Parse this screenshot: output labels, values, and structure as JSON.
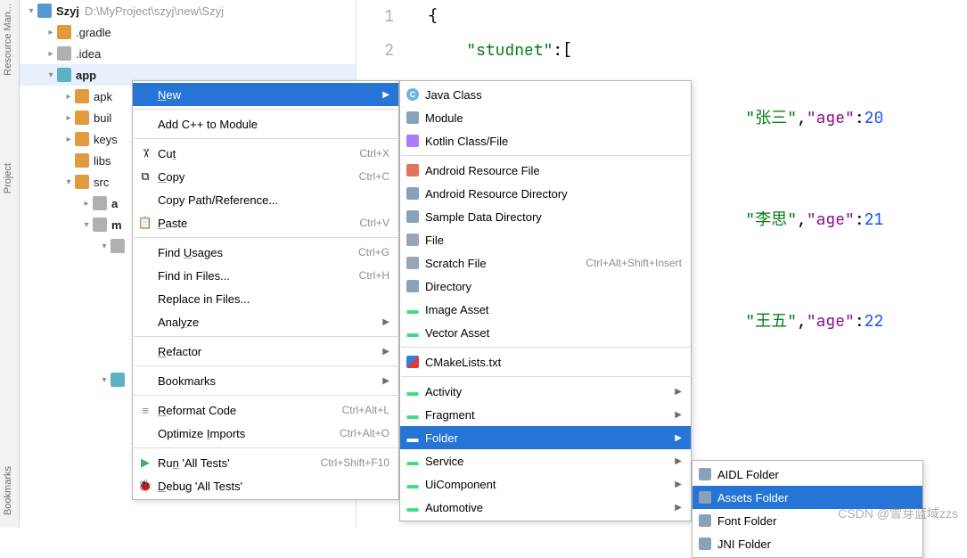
{
  "sidebar_tabs": [
    "Resource Man...",
    "Project",
    "Bookmarks"
  ],
  "tree": {
    "root_name": "Szyj",
    "root_path": "D:\\MyProject\\szyj\\new\\Szyj",
    "children": [
      {
        "name": ".gradle",
        "icon": "folder-orange"
      },
      {
        "name": ".idea",
        "icon": "folder-grey"
      },
      {
        "name": "app",
        "icon": "folder-teal",
        "bold": true,
        "selected": true,
        "expanded": true,
        "children": [
          {
            "name": "apk"
          },
          {
            "name": "buil"
          },
          {
            "name": "keys"
          },
          {
            "name": "libs"
          },
          {
            "name": "src",
            "expanded": true,
            "children": [
              {
                "name": "a",
                "bold": true
              },
              {
                "name": "m",
                "bold": true,
                "expanded": true,
                "children": [
                  {
                    "name": ""
                  },
                  {
                    "name": ""
                  }
                ]
              }
            ]
          }
        ]
      }
    ]
  },
  "editor": {
    "lines_visible": [
      "1",
      "2"
    ],
    "code": {
      "l1": "{",
      "key_studnet": "\"studnet\"",
      "arr_open": ":[",
      "row1_name": "\"张三\"",
      "row1_agek": "\"age\"",
      "row1_agev": "20",
      "row2_name": "\"李思\"",
      "row2_agek": "\"age\"",
      "row2_agev": "21",
      "row3_name": "\"王五\"",
      "row3_agek": "\"age\"",
      "row3_agev": "22"
    }
  },
  "ctx": {
    "items": [
      {
        "label": "New",
        "hl": true,
        "arrow": true,
        "u": 0
      },
      {
        "sep": true
      },
      {
        "label": "Add C++ to Module"
      },
      {
        "sep": true
      },
      {
        "icon": "scissors",
        "label": "Cut",
        "sc": "Ctrl+X",
        "u": 2
      },
      {
        "icon": "copy",
        "label": "Copy",
        "sc": "Ctrl+C",
        "u": 0
      },
      {
        "label": "Copy Path/Reference..."
      },
      {
        "icon": "paste",
        "label": "Paste",
        "sc": "Ctrl+V",
        "u": 0
      },
      {
        "sep": true
      },
      {
        "label": "Find Usages",
        "sc": "Ctrl+G",
        "u": 5
      },
      {
        "label": "Find in Files...",
        "sc": "Ctrl+H"
      },
      {
        "label": "Replace in Files..."
      },
      {
        "label": "Analyze",
        "arrow": true,
        "u": 4
      },
      {
        "sep": true
      },
      {
        "label": "Refactor",
        "arrow": true,
        "u": 0
      },
      {
        "sep": true
      },
      {
        "label": "Bookmarks",
        "arrow": true
      },
      {
        "sep": true
      },
      {
        "icon": "reformat",
        "label": "Reformat Code",
        "sc": "Ctrl+Alt+L",
        "u": 0
      },
      {
        "label": "Optimize Imports",
        "sc": "Ctrl+Alt+O",
        "u": 9
      },
      {
        "sep": true
      },
      {
        "icon": "play",
        "label": "Run 'All Tests'",
        "sc": "Ctrl+Shift+F10",
        "u": 2
      },
      {
        "icon": "bug",
        "label": "Debug 'All Tests'",
        "u": 0
      }
    ]
  },
  "sub": {
    "items": [
      {
        "icon": "java",
        "label": "Java Class"
      },
      {
        "icon": "folder",
        "label": "Module"
      },
      {
        "icon": "kotlin",
        "label": "Kotlin Class/File"
      },
      {
        "sep": true
      },
      {
        "icon": "xml",
        "label": "Android Resource File"
      },
      {
        "icon": "folder",
        "label": "Android Resource Directory"
      },
      {
        "icon": "folder",
        "label": "Sample Data Directory"
      },
      {
        "icon": "file",
        "label": "File"
      },
      {
        "icon": "file",
        "label": "Scratch File",
        "sc": "Ctrl+Alt+Shift+Insert"
      },
      {
        "icon": "folder",
        "label": "Directory"
      },
      {
        "icon": "android",
        "label": "Image Asset"
      },
      {
        "icon": "android",
        "label": "Vector Asset"
      },
      {
        "sep": true
      },
      {
        "icon": "cmake",
        "label": "CMakeLists.txt"
      },
      {
        "sep": true
      },
      {
        "icon": "android",
        "label": "Activity",
        "arrow": true
      },
      {
        "icon": "android",
        "label": "Fragment",
        "arrow": true
      },
      {
        "icon": "android",
        "label": "Folder",
        "arrow": true,
        "hl": true
      },
      {
        "icon": "android",
        "label": "Service",
        "arrow": true
      },
      {
        "icon": "android",
        "label": "UiComponent",
        "arrow": true
      },
      {
        "icon": "android",
        "label": "Automotive",
        "arrow": true
      }
    ]
  },
  "sub2": {
    "items": [
      {
        "icon": "folderf",
        "label": "AIDL Folder"
      },
      {
        "icon": "folderf",
        "label": "Assets Folder",
        "hl": true
      },
      {
        "icon": "folderf",
        "label": "Font Folder"
      },
      {
        "icon": "folderf",
        "label": "JNI Folder"
      }
    ]
  },
  "watermark": "CSDN @雪芽蓝域zzs"
}
